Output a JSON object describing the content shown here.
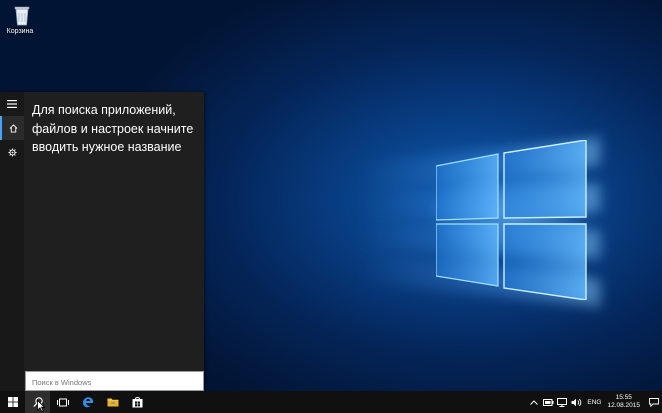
{
  "desktop": {
    "icons": [
      {
        "label": "Корзина",
        "icon": "recycle-bin-icon"
      }
    ]
  },
  "start_menu": {
    "rail": [
      {
        "icon": "hamburger-menu-icon"
      },
      {
        "icon": "home-icon",
        "active": true
      },
      {
        "icon": "gear-icon"
      }
    ],
    "hint_text": "Для поиска приложений, файлов и настроек начните вводить нужное название",
    "search_placeholder": "Поиск в Windows"
  },
  "taskbar": {
    "buttons": [
      {
        "icon": "windows-start-icon"
      },
      {
        "icon": "search-icon",
        "active": true
      },
      {
        "icon": "task-view-icon"
      },
      {
        "icon": "edge-icon"
      },
      {
        "icon": "file-explorer-icon"
      },
      {
        "icon": "store-icon"
      }
    ],
    "tray": {
      "icons": [
        "chevron-up-icon",
        "battery-icon",
        "network-icon",
        "volume-icon",
        "notification-icon"
      ],
      "language": "ENG",
      "time": "15:55",
      "date": "12.08.2015"
    }
  },
  "colors": {
    "accent": "#4aa0ff",
    "start_bg": "#1f1f1f",
    "taskbar_bg": "#101010"
  }
}
